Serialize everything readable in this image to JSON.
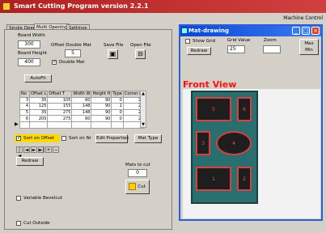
{
  "app": {
    "title": "Smart Cutting Program version 2.2.1",
    "machine_control": "Machine Control"
  },
  "tabs": [
    {
      "label": "Single Opening"
    },
    {
      "label": "Multi Opening"
    },
    {
      "label": "Settings"
    }
  ],
  "board": {
    "width_label": "Board Width",
    "width_value": "300",
    "height_label": "Board Height",
    "height_value": "400"
  },
  "offset": {
    "label_line1": "Offset Double Mat",
    "value": "5",
    "double_mat_label": "Double Mat",
    "double_mat_checked": true
  },
  "file": {
    "save_label": "Save File",
    "open_label": "Open File"
  },
  "autofit_label": "AutoFit",
  "grid": {
    "headers": [
      "No",
      "Offset L",
      "Offset T",
      "Width W",
      "Height H",
      "Type",
      "Corner ra"
    ],
    "rows": [
      [
        "3",
        "35",
        "105",
        "60",
        "90",
        "0",
        "20"
      ],
      [
        "4",
        "125",
        "155",
        "148",
        "90",
        "1",
        "20"
      ],
      [
        "5",
        "35",
        "275",
        "148",
        "90",
        "0",
        "20"
      ],
      [
        "6",
        "205",
        "275",
        "60",
        "90",
        "0",
        "20"
      ],
      [
        "",
        "",
        "",
        "",
        "",
        "",
        ""
      ]
    ]
  },
  "controls": {
    "sort_offset_label": "Sort on Offset",
    "sort_offset_checked": true,
    "sort_nr_label": "Sort on Nr",
    "sort_nr_checked": false,
    "edit_properties_label": "Edit Properties",
    "mat_type_label": "Mat Type",
    "nav": [
      "|◄",
      "◄",
      "►",
      "►|",
      "+",
      "−"
    ],
    "redraw_label": "Redraw",
    "mats_to_cut_label": "Mats to cut",
    "mats_to_cut_value": "0",
    "cut_label": "Cut",
    "variable_bevelcut_label": "Variable Bevelcut",
    "cut_outside_label": "Cut Outside"
  },
  "mat_drawing": {
    "title": "Mat-drawing",
    "show_grid_label": "Show Grid",
    "redraw_label": "Redraw",
    "grid_value_label": "Grid Value",
    "grid_value": "25",
    "zoom_label": "Zoom",
    "maxmin_line1": "Max",
    "maxmin_line2": "Min",
    "front_view_label": "Front View",
    "openings": [
      {
        "number": "5"
      },
      {
        "number": "6"
      },
      {
        "number": "3"
      },
      {
        "number": "4"
      },
      {
        "number": "1"
      },
      {
        "number": "2"
      }
    ]
  }
}
